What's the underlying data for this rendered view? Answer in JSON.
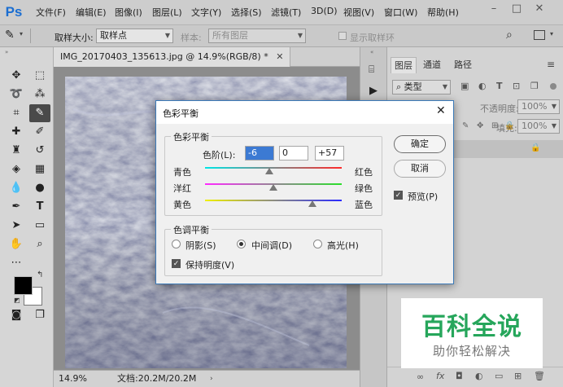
{
  "app": {
    "logo": "Ps",
    "menu": [
      "文件(F)",
      "编辑(E)",
      "图像(I)",
      "图层(L)",
      "文字(Y)",
      "选择(S)",
      "滤镜(T)",
      "3D(D)",
      "视图(V)",
      "窗口(W)",
      "帮助(H)"
    ]
  },
  "options_bar": {
    "sample_size_label": "取样大小:",
    "sample_size_value": "取样点",
    "sample_label": "样本:",
    "sample_value": "所有图层",
    "show_ring_label": "显示取样环"
  },
  "document": {
    "tab_title": "IMG_20170403_135613.jpg @ 14.9%(RGB/8) *",
    "zoom": "14.9%",
    "doc_size": "文档:20.2M/20.2M"
  },
  "layers_panel": {
    "tabs": [
      "图层",
      "通道",
      "路径"
    ],
    "filter_kind": "类型",
    "opacity_label": "不透明度:",
    "opacity_value": "100%",
    "fill_label": "填充:",
    "fill_value": "100%"
  },
  "dialog": {
    "title": "色彩平衡",
    "balance_group": "色彩平衡",
    "levels_label": "色阶(L):",
    "levels": [
      "-6",
      "0",
      "+57"
    ],
    "sliders": [
      {
        "left": "青色",
        "right": "红色",
        "value": -6
      },
      {
        "left": "洋红",
        "right": "绿色",
        "value": 0
      },
      {
        "left": "黄色",
        "right": "蓝色",
        "value": 57
      }
    ],
    "tone_group": "色调平衡",
    "tones": [
      {
        "label": "阴影(S)",
        "selected": false
      },
      {
        "label": "中间调(D)",
        "selected": true
      },
      {
        "label": "高光(H)",
        "selected": false
      }
    ],
    "preserve_luminosity": "保持明度(V)",
    "preserve_checked": true,
    "ok": "确定",
    "cancel": "取消",
    "preview": "预览(P)",
    "preview_checked": true
  },
  "watermark": {
    "title": "百科全说",
    "subtitle": "助你轻松解决"
  }
}
